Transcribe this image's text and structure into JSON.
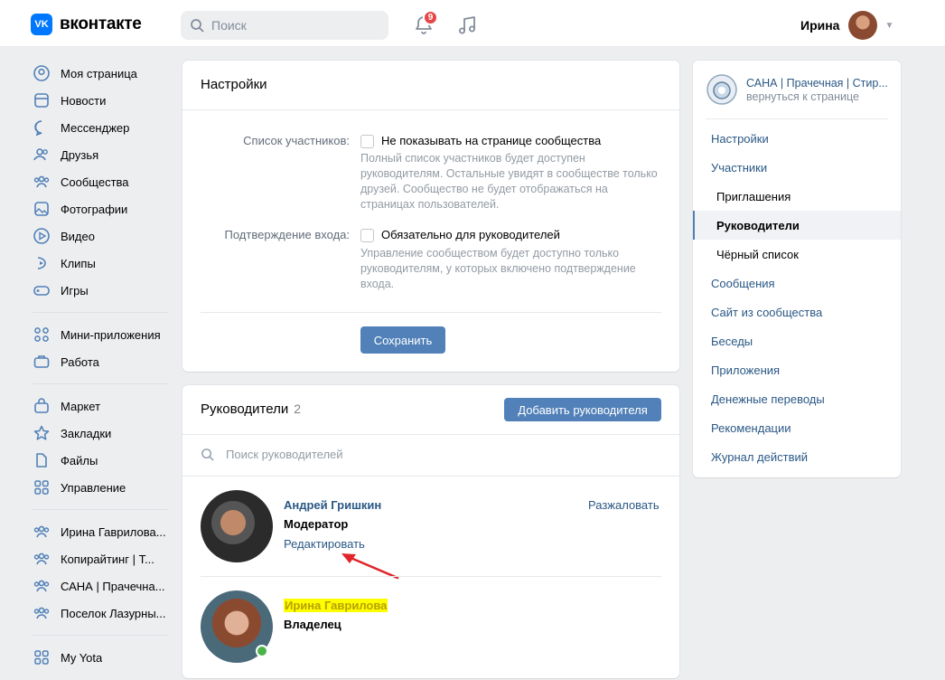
{
  "header": {
    "logo_text": "вконтакте",
    "logo_mark": "VK",
    "search_placeholder": "Поиск",
    "notifications_count": "9",
    "user_name": "Ирина"
  },
  "sidebar": {
    "group1": [
      "Моя страница",
      "Новости",
      "Мессенджер",
      "Друзья",
      "Сообщества",
      "Фотографии",
      "Видео",
      "Клипы",
      "Игры"
    ],
    "group2": [
      "Мини-приложения",
      "Работа"
    ],
    "group3": [
      "Маркет",
      "Закладки",
      "Файлы",
      "Управление"
    ],
    "group4": [
      "Ирина Гаврилова...",
      "Копирайтинг | Т...",
      "САНА | Прачечна...",
      "Поселок Лазурны..."
    ],
    "group5": [
      "My Yota"
    ]
  },
  "settings": {
    "title": "Настройки",
    "members_label": "Список участников:",
    "members_checkbox": "Не показывать на странице сообщества",
    "members_hint": "Полный список участников будет доступен руководителям. Остальные увидят в сообществе только друзей. Сообщество не будет отображаться на страницах пользователей.",
    "login_label": "Подтверждение входа:",
    "login_checkbox": "Обязательно для руководителей",
    "login_hint": "Управление сообществом будет доступно только руководителям, у которых включено подтверждение входа.",
    "save_button": "Сохранить"
  },
  "managers": {
    "title": "Руководители",
    "count": "2",
    "add_button": "Добавить руководителя",
    "search_placeholder": "Поиск руководителей",
    "list": [
      {
        "name": "Андрей Гришкин",
        "role": "Модератор",
        "edit": "Редактировать",
        "demote": "Разжаловать"
      },
      {
        "name": "Ирина Гаврилова",
        "role": "Владелец"
      }
    ]
  },
  "right_menu": {
    "community_name": "САНА | Прачечная | Стир...",
    "back_link": "вернуться к странице",
    "items": [
      {
        "label": "Настройки"
      },
      {
        "label": "Участники"
      },
      {
        "label": "Приглашения"
      },
      {
        "label": "Руководители"
      },
      {
        "label": "Чёрный список"
      },
      {
        "label": "Сообщения"
      },
      {
        "label": "Сайт из сообщества"
      },
      {
        "label": "Беседы"
      },
      {
        "label": "Приложения"
      },
      {
        "label": "Денежные переводы"
      },
      {
        "label": "Рекомендации"
      },
      {
        "label": "Журнал действий"
      }
    ],
    "active_item": "Руководители"
  },
  "colors": {
    "accent": "#5181b8",
    "link": "#2a5885",
    "highlight": "#ffff00",
    "online": "#4bb34b",
    "annotation_arrow": "#e0242a"
  },
  "icons": {
    "sidebar": [
      "user-circle-icon",
      "news-icon",
      "message-icon",
      "friends-icon",
      "groups-icon",
      "photo-icon",
      "video-icon",
      "clips-icon",
      "games-icon",
      "apps-icon",
      "briefcase-icon",
      "shop-icon",
      "star-icon",
      "file-icon",
      "grid-icon",
      "community-icon",
      "community-icon",
      "community-icon",
      "community-icon",
      "grid-icon"
    ]
  }
}
